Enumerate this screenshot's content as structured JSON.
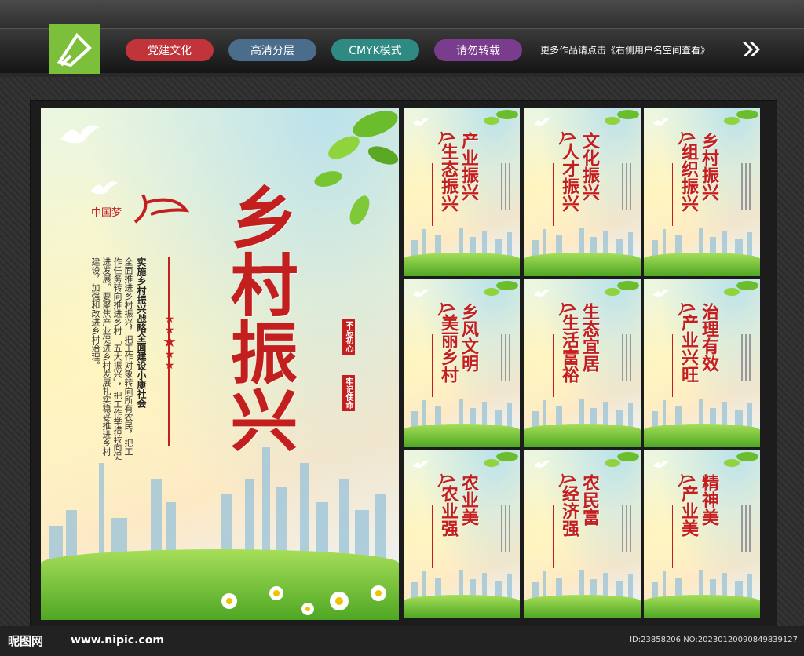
{
  "header": {
    "pills": [
      {
        "label": "党建文化",
        "color": "#c0343a"
      },
      {
        "label": "高清分层",
        "color": "#4a6d8c"
      },
      {
        "label": "CMYK模式",
        "color": "#2f8a84"
      },
      {
        "label": "请勿转载",
        "color": "#7a3c8c"
      }
    ],
    "note": "更多作品请点击《右侧用户名空间查看》"
  },
  "main_poster": {
    "title": "乡村振兴",
    "subtitle": "实施乡村振兴战略全面建设小康社会",
    "body": "全面推进乡村振兴，把工作对象转向所有农民，把工作任务转向推进乡村「五大振兴」，把工作举措转向促进发展。要聚焦产业促进乡村发展扎实稳妥推进乡村建设，加强和改进乡村治理。",
    "slogan_a": "不忘初心",
    "slogan_b": "牢记使命",
    "logo_text": "中国梦"
  },
  "small_posters": [
    {
      "line1": "产业振兴",
      "line2": "生态振兴"
    },
    {
      "line1": "文化振兴",
      "line2": "人才振兴"
    },
    {
      "line1": "乡村振兴",
      "line2": "组织振兴"
    },
    {
      "line1": "乡风文明",
      "line2": "美丽乡村"
    },
    {
      "line1": "生态宜居",
      "line2": "生活富裕"
    },
    {
      "line1": "治理有效",
      "line2": "产业兴旺"
    },
    {
      "line1": "农业美",
      "line2": "农业强"
    },
    {
      "line1": "农民富",
      "line2": "经济强"
    },
    {
      "line1": "精神美",
      "line2": "产业美"
    }
  ],
  "footer": {
    "brand": "昵图网",
    "site": "www.nipic.com",
    "id": "ID:23858206 NO:20230120090849839127"
  }
}
